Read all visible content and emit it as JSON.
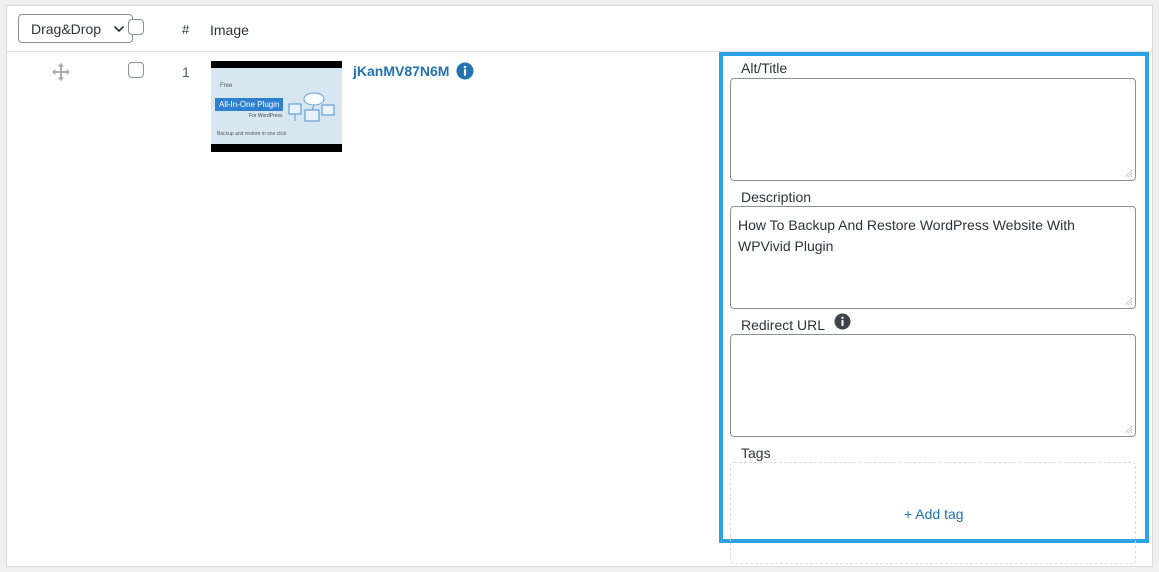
{
  "toolbar": {
    "sort_select_value": "Drag&Drop"
  },
  "table": {
    "columns": {
      "number": "#",
      "image": "Image"
    },
    "rows": [
      {
        "number": "1",
        "file_name": "jKanMV87N6M",
        "thumbnail": {
          "line1": "Free",
          "line2": "All-In-One Plugin",
          "line3": "For WordPress",
          "line4": "Backup and restore in one click"
        }
      }
    ]
  },
  "details": {
    "alt_label": "Alt/Title",
    "alt_value": "",
    "description_label": "Description",
    "description_value": "How To Backup And Restore WordPress Website With WPVivid Plugin",
    "redirect_label": "Redirect URL",
    "redirect_value": "",
    "tags_label": "Tags",
    "add_tag_label": "+ Add tag"
  },
  "colors": {
    "accent": "#2271b1",
    "highlight_border": "#2ea2e6"
  },
  "icons": {
    "sort_chevron": "chevron-down-icon",
    "drag_handle": "move-icon",
    "file_info": "info-icon",
    "redirect_info": "info-icon"
  }
}
